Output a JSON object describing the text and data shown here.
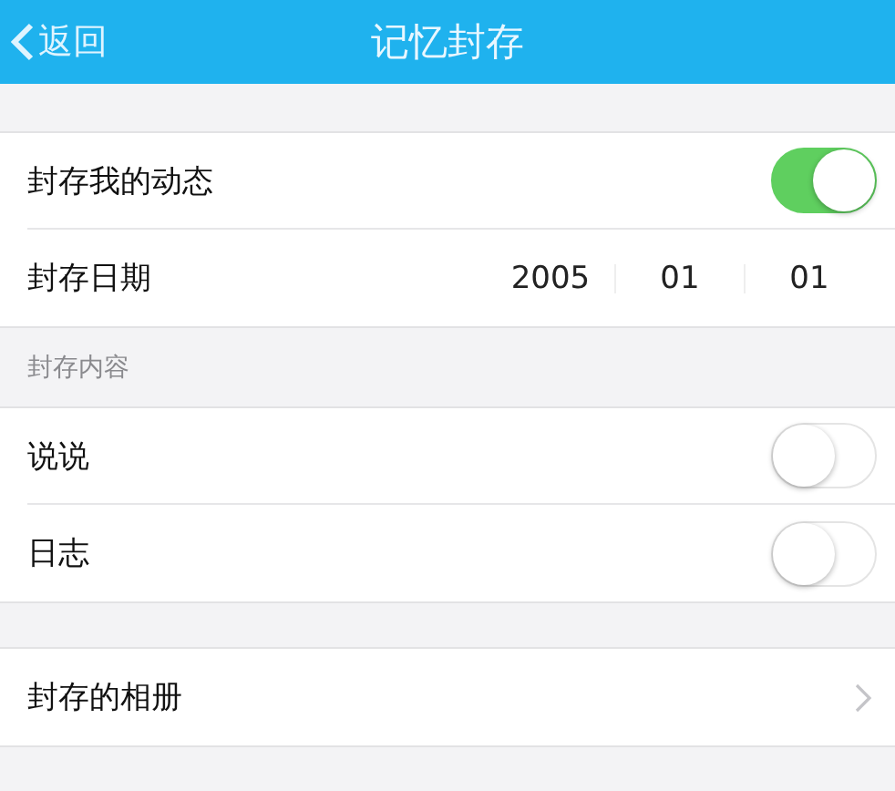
{
  "nav_bar": {
    "back_label": "返回",
    "title": "记忆封存"
  },
  "top_rows": [
    {
      "kind": "toggle",
      "label": "封存我的动态",
      "on": true
    },
    {
      "kind": "date",
      "label": "封存日期",
      "parts": [
        "2005",
        "01",
        "01"
      ]
    }
  ],
  "content_section": {
    "header": "封存内容",
    "rows": [
      {
        "kind": "toggle",
        "label": "说说",
        "on": false
      },
      {
        "kind": "toggle",
        "label": "日志",
        "on": false
      }
    ]
  },
  "bottom_rows": [
    {
      "kind": "link",
      "label": "封存的相册"
    }
  ]
}
